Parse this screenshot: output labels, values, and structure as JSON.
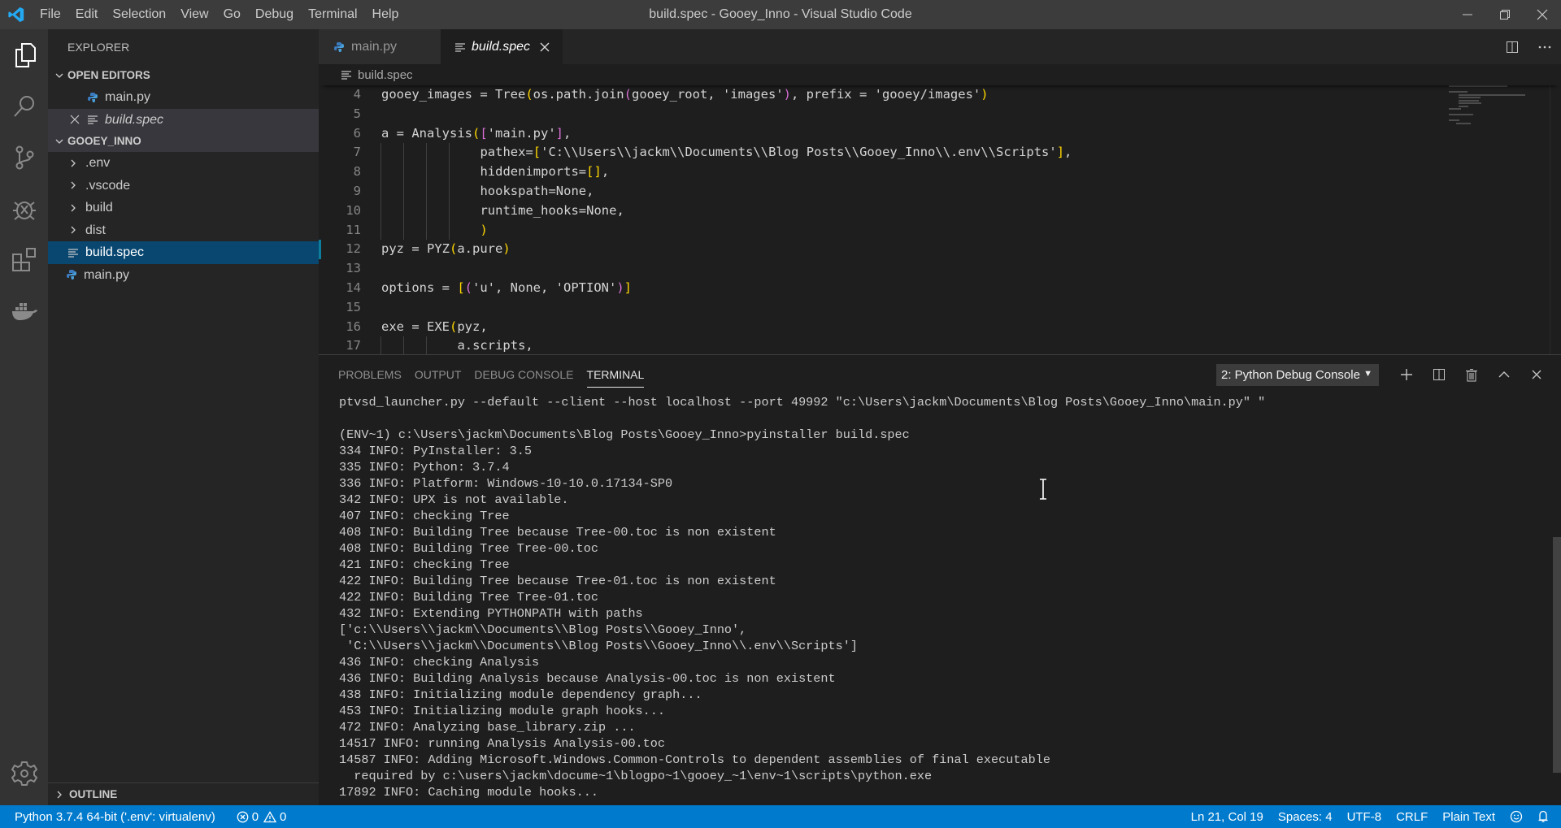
{
  "window": {
    "title": "build.spec - Gooey_Inno - Visual Studio Code",
    "menu": [
      "File",
      "Edit",
      "Selection",
      "View",
      "Go",
      "Debug",
      "Terminal",
      "Help"
    ],
    "controls": {
      "minimize": "minimize-icon",
      "restore": "restore-icon",
      "close": "close-icon"
    }
  },
  "activity_bar": {
    "items": [
      {
        "name": "explorer",
        "icon": "files-icon",
        "active": true
      },
      {
        "name": "search",
        "icon": "search-icon"
      },
      {
        "name": "source-control",
        "icon": "source-control-icon"
      },
      {
        "name": "debug",
        "icon": "debug-icon"
      },
      {
        "name": "extensions",
        "icon": "extensions-icon"
      },
      {
        "name": "docker",
        "icon": "docker-icon"
      }
    ],
    "bottom": {
      "name": "manage",
      "icon": "gear-icon"
    }
  },
  "sidebar": {
    "title": "EXPLORER",
    "open_editors": {
      "label": "OPEN EDITORS",
      "items": [
        {
          "label": "main.py",
          "icon": "python-file-icon"
        },
        {
          "label": "build.spec",
          "icon": "text-file-icon",
          "active": true
        }
      ]
    },
    "workspace": {
      "label": "GOOEY_INNO",
      "items": [
        {
          "label": ".env",
          "type": "folder"
        },
        {
          "label": ".vscode",
          "type": "folder"
        },
        {
          "label": "build",
          "type": "folder"
        },
        {
          "label": "dist",
          "type": "folder"
        },
        {
          "label": "build.spec",
          "type": "file",
          "selected": true
        },
        {
          "label": "main.py",
          "type": "python-file"
        }
      ]
    },
    "outline_label": "OUTLINE"
  },
  "editor": {
    "tabs": [
      {
        "label": "main.py",
        "active": false
      },
      {
        "label": "build.spec",
        "active": true
      }
    ],
    "breadcrumb": "build.spec",
    "lines": [
      {
        "n": "4",
        "text": "gooey_images = Tree(os.path.join(gooey_root, 'images'), prefix = 'gooey/images')"
      },
      {
        "n": "5",
        "text": ""
      },
      {
        "n": "6",
        "text": "a = Analysis(['main.py'],"
      },
      {
        "n": "7",
        "text": "             pathex=['C:\\\\Users\\\\jackm\\\\Documents\\\\Blog Posts\\\\Gooey_Inno\\\\.env\\\\Scripts'],"
      },
      {
        "n": "8",
        "text": "             hiddenimports=[],"
      },
      {
        "n": "9",
        "text": "             hookspath=None,"
      },
      {
        "n": "10",
        "text": "             runtime_hooks=None,"
      },
      {
        "n": "11",
        "text": "             )"
      },
      {
        "n": "12",
        "text": "pyz = PYZ(a.pure)"
      },
      {
        "n": "13",
        "text": ""
      },
      {
        "n": "14",
        "text": "options = [('u', None, 'OPTION')]"
      },
      {
        "n": "15",
        "text": ""
      },
      {
        "n": "16",
        "text": "exe = EXE(pyz,"
      },
      {
        "n": "17",
        "text": "          a.scripts,"
      }
    ]
  },
  "panel": {
    "tabs": [
      "PROBLEMS",
      "OUTPUT",
      "DEBUG CONSOLE",
      "TERMINAL"
    ],
    "active_tab": "TERMINAL",
    "terminal_select": "2: Python Debug Console",
    "actions": [
      "plus-icon",
      "split-terminal-icon",
      "trash-icon",
      "maximize-panel-icon",
      "close-panel-icon"
    ],
    "terminal_lines": [
      "ptvsd_launcher.py --default --client --host localhost --port 49992 \"c:\\Users\\jackm\\Documents\\Blog Posts\\Gooey_Inno\\main.py\" \"",
      "",
      "(ENV~1) c:\\Users\\jackm\\Documents\\Blog Posts\\Gooey_Inno>pyinstaller build.spec",
      "334 INFO: PyInstaller: 3.5",
      "335 INFO: Python: 3.7.4",
      "336 INFO: Platform: Windows-10-10.0.17134-SP0",
      "342 INFO: UPX is not available.",
      "407 INFO: checking Tree",
      "408 INFO: Building Tree because Tree-00.toc is non existent",
      "408 INFO: Building Tree Tree-00.toc",
      "421 INFO: checking Tree",
      "422 INFO: Building Tree because Tree-01.toc is non existent",
      "422 INFO: Building Tree Tree-01.toc",
      "432 INFO: Extending PYTHONPATH with paths",
      "['c:\\\\Users\\\\jackm\\\\Documents\\\\Blog Posts\\\\Gooey_Inno',",
      " 'C:\\\\Users\\\\jackm\\\\Documents\\\\Blog Posts\\\\Gooey_Inno\\\\.env\\\\Scripts']",
      "436 INFO: checking Analysis",
      "436 INFO: Building Analysis because Analysis-00.toc is non existent",
      "438 INFO: Initializing module dependency graph...",
      "453 INFO: Initializing module graph hooks...",
      "472 INFO: Analyzing base_library.zip ...",
      "14517 INFO: running Analysis Analysis-00.toc",
      "14587 INFO: Adding Microsoft.Windows.Common-Controls to dependent assemblies of final executable",
      "  required by c:\\users\\jackm\\docume~1\\blogpo~1\\gooey_~1\\env~1\\scripts\\python.exe",
      "17892 INFO: Caching module hooks..."
    ]
  },
  "statusbar": {
    "interpreter": "Python 3.7.4 64-bit ('.env': virtualenv)",
    "errors": "0",
    "warnings": "0",
    "position": "Ln 21, Col 19",
    "indent": "Spaces: 4",
    "encoding": "UTF-8",
    "eol": "CRLF",
    "language": "Plain Text",
    "feedback_icon": "smiley-icon",
    "notifications_icon": "bell-icon"
  },
  "colors": {
    "accent": "#007acc",
    "selection": "#094771",
    "titlebar": "#3c3c3c",
    "activitybar": "#333333",
    "sidebar": "#252526",
    "editor": "#1e1e1e"
  }
}
